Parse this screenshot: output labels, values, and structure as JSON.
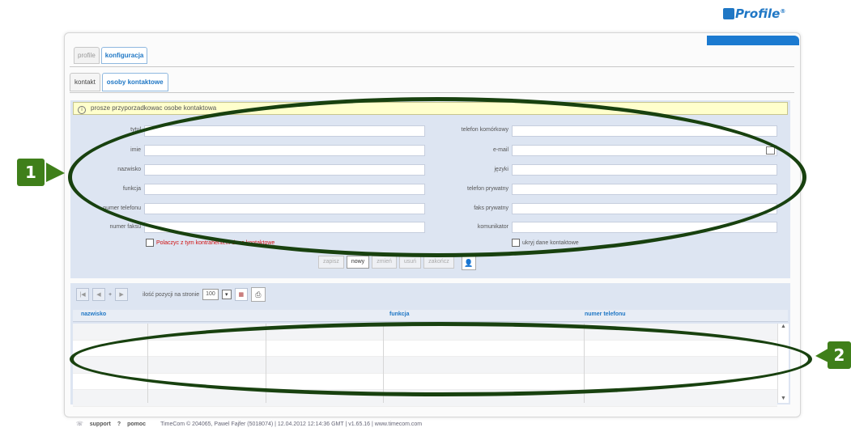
{
  "logo": "Profile",
  "logo_mark": "®",
  "tabs_top": [
    "profile",
    "konfiguracja"
  ],
  "tabs_sub": [
    "kontakt",
    "osoby kontaktowe"
  ],
  "notice": "prosze przyporzadkowac osobe kontaktowa",
  "form": {
    "left_labels": [
      "tytul",
      "imie",
      "nazwisko",
      "funkcja",
      "numer telefonu",
      "numer faksu"
    ],
    "right_labels": [
      "telefon komórkowy",
      "e-mail",
      "języki",
      "telefon prywatny",
      "faks prywatny",
      "komunikator"
    ],
    "checkbox_left": "Polaczyc z tym kontrahentem dane kontaktowe",
    "checkbox_right": "ukryj dane kontaktowe"
  },
  "buttons": [
    "zapisz",
    "nowy",
    "zmień",
    "usuń",
    "zakończ"
  ],
  "pager": {
    "plus": "+",
    "per_page_label": "ilość pozycji na stronie",
    "per_page_value": "100"
  },
  "table": {
    "headers": [
      "nazwisko",
      "funkcja",
      "numer telefonu"
    ]
  },
  "footer": {
    "support": "support",
    "help": "pomoc",
    "info": "TimeCom © 204065, Pawel Fajfer (5018074) | 12.04.2012 12:14:36 GMT | v1.65.16 | www.timecom.com"
  },
  "callouts": [
    "1",
    "2"
  ],
  "icons": [
    "info-icon",
    "person-icon",
    "print-icon",
    "export-icon",
    "dropdown-arrow-icon",
    "support-icon",
    "help-icon",
    "calendar-icon"
  ]
}
